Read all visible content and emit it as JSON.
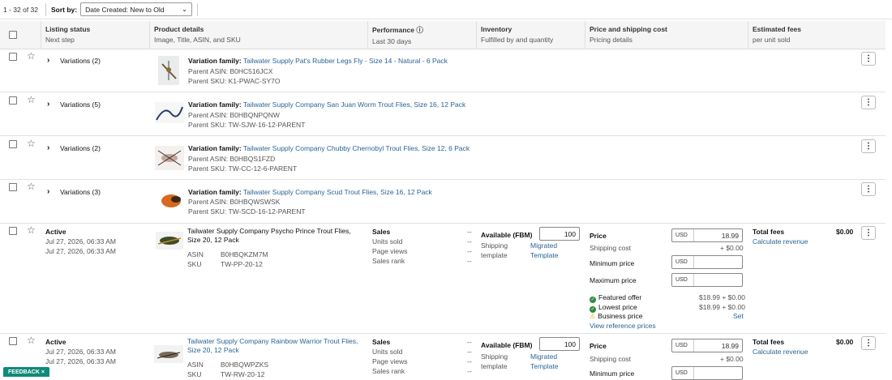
{
  "toolbar": {
    "count": "1 - 32 of 32",
    "sort_label": "Sort by:",
    "sort_value": "Date Created: New to Old"
  },
  "columns": [
    {
      "title": "Listing status",
      "sub": "Next step"
    },
    {
      "title": "Product details",
      "sub": "Image, Title, ASIN, and SKU"
    },
    {
      "title": "Performance",
      "sub": "Last 30 days"
    },
    {
      "title": "Inventory",
      "sub": "Fulfilled by and quantity"
    },
    {
      "title": "Price and shipping cost",
      "sub": "Pricing details"
    },
    {
      "title": "Estimated fees",
      "sub": "per unit sold"
    }
  ],
  "families": [
    {
      "variations": "Variations (2)",
      "family_label": "Variation family:",
      "title": "Tailwater Supply Pat's Rubber Legs Fly - Size 14 - Natural - 6 Pack",
      "asin": "Parent ASIN: B0HC516JCX",
      "sku": "Parent SKU: K1-PWAC-SY7O"
    },
    {
      "variations": "Variations (5)",
      "family_label": "Variation family:",
      "title": "Tailwater Supply Company San Juan Worm Trout Flies, Size 16, 12 Pack",
      "asin": "Parent ASIN: B0HBQNPQNW",
      "sku": "Parent SKU: TW-SJW-16-12-PARENT"
    },
    {
      "variations": "Variations (2)",
      "family_label": "Variation family:",
      "title": "Tailwater Supply Company Chubby Chernobyl Trout Flies, Size 12, 6 Pack",
      "asin": "Parent ASIN: B0HBQS1FZD",
      "sku": "Parent SKU: TW-CC-12-6-PARENT"
    },
    {
      "variations": "Variations (3)",
      "family_label": "Variation family:",
      "title": "Tailwater Supply Company Scud Trout Flies, Size 16, 12 Pack",
      "asin": "Parent ASIN: B0HBQWSWSK",
      "sku": "Parent SKU: TW-SCD-16-12-PARENT"
    }
  ],
  "listings": [
    {
      "status": "Active",
      "date1": "Jul 27, 2026, 06:33 AM",
      "date2": "Jul 27, 2026, 06:33 AM",
      "title": "Tailwater Supply Company Psycho Prince Trout Flies, Size 20, 12 Pack",
      "asin_label": "ASIN",
      "asin": "B0HBQKZM7M",
      "sku_label": "SKU",
      "sku": "TW-PP-20-12",
      "perf": [
        {
          "k": "Sales",
          "v": "--"
        },
        {
          "k": "Units sold",
          "v": "--"
        },
        {
          "k": "Page views",
          "v": "--"
        },
        {
          "k": "Sales rank",
          "v": "--"
        }
      ],
      "avail_label": "Available (FBM)",
      "qty": "100",
      "ship_label1": "Shipping",
      "ship_label2": "template",
      "ship_val1": "Migrated",
      "ship_val2": "Template",
      "price_label": "Price",
      "currency": "USD",
      "price": "18.99",
      "shipping_label": "Shipping cost",
      "shipping_val": "+ $0.00",
      "min_label": "Minimum price",
      "max_label": "Maximum price",
      "featured_label": "Featured offer",
      "featured_val": "$18.99 + $0.00",
      "lowest_label": "Lowest price",
      "lowest_val": "$18.99 + $0.00",
      "business_label": "Business price",
      "business_val": "Set",
      "ref_link": "View reference prices",
      "fees_label": "Total fees",
      "fees_val": "$0.00",
      "calc_link": "Calculate revenue"
    },
    {
      "status": "Active",
      "date1": "Jul 27, 2026, 06:33 AM",
      "date2": "Jul 27, 2026, 06:33 AM",
      "title": "Tailwater Supply Company Rainbow Warrior Trout Flies, Size 20, 12 Pack",
      "asin_label": "ASIN",
      "asin": "B0HBQWPZKS",
      "sku_label": "SKU",
      "sku": "TW-RW-20-12",
      "perf": [
        {
          "k": "Sales",
          "v": "--"
        },
        {
          "k": "Units sold",
          "v": "--"
        },
        {
          "k": "Page views",
          "v": "--"
        },
        {
          "k": "Sales rank",
          "v": "--"
        }
      ],
      "avail_label": "Available (FBM)",
      "qty": "100",
      "ship_label1": "Shipping",
      "ship_label2": "template",
      "ship_val1": "Migrated",
      "ship_val2": "Template",
      "price_label": "Price",
      "currency": "USD",
      "price": "18.99",
      "shipping_label": "Shipping cost",
      "shipping_val": "+ $0.00",
      "min_label": "Minimum price",
      "fees_label": "Total fees",
      "fees_val": "$0.00",
      "calc_link": "Calculate revenue"
    }
  ],
  "feedback": "FEEDBACK",
  "icons": {
    "close": "×",
    "kebab": "⋮",
    "star": "☆",
    "chevron": "›",
    "info": "ⓘ",
    "check": "✓",
    "warning": "⚠"
  }
}
